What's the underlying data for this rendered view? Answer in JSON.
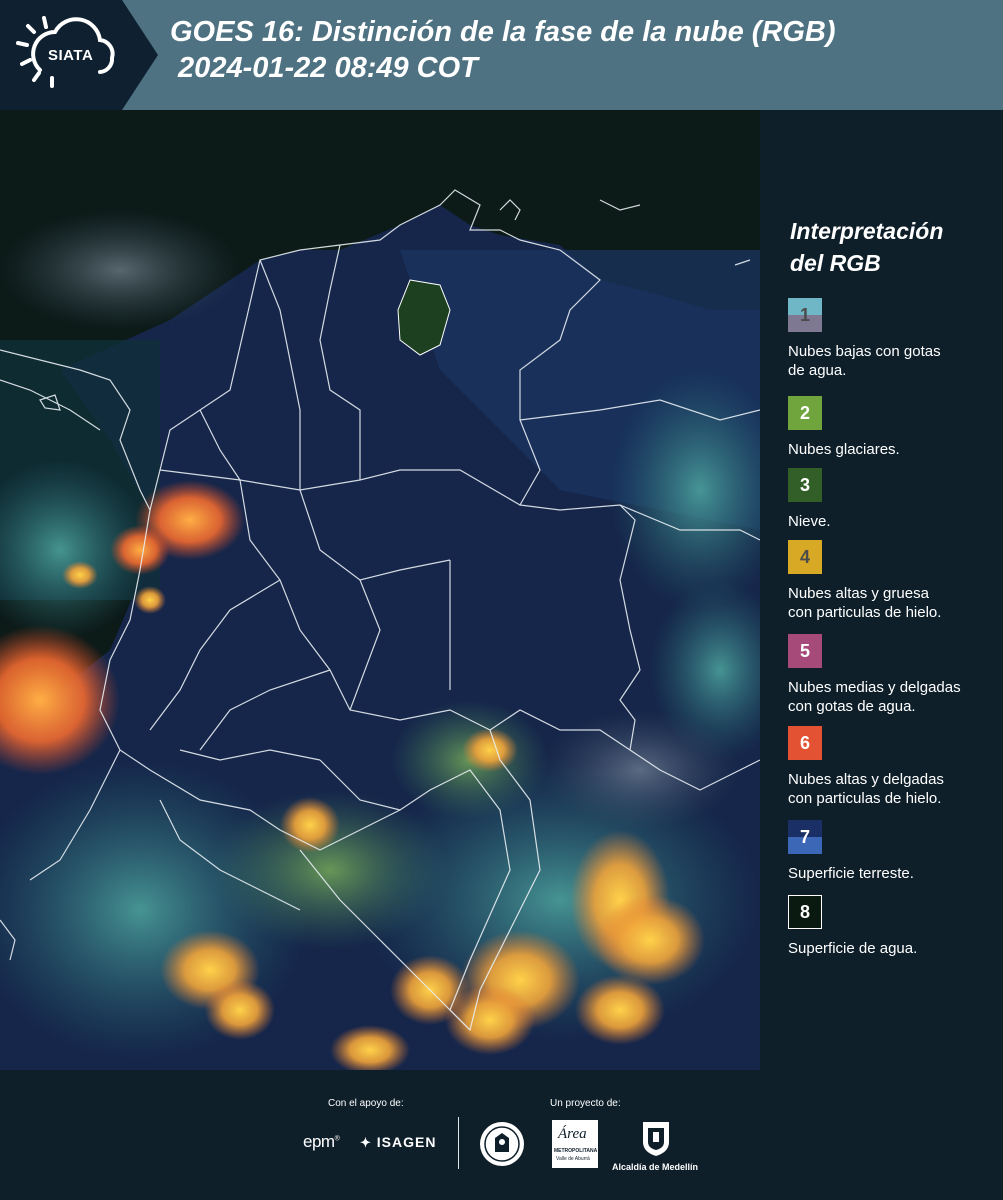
{
  "header": {
    "logo_text": "SIATA",
    "title_line1": "GOES 16: Distinción de la fase de la nube (RGB)",
    "title_line2": " 2024-01-22 08:49 COT"
  },
  "legend": {
    "title_line1": "Interpretación",
    "title_line2": "del RGB",
    "items": [
      {
        "number": "1",
        "label_line1": "Nubes bajas con gotas",
        "label_line2": "de agua.",
        "color_top": "#6fb6c6",
        "color_bottom": "#7e7892"
      },
      {
        "number": "2",
        "label_line1": "Nubes glaciares.",
        "label_line2": "",
        "color_top": "#6fa53c",
        "color_bottom": "#6fa53c"
      },
      {
        "number": "3",
        "label_line1": "Nieve.",
        "label_line2": "",
        "color_top": "#325f27",
        "color_bottom": "#325f27"
      },
      {
        "number": "4",
        "label_line1": "Nubes altas y gruesa",
        "label_line2": "con particulas de hielo.",
        "color_top": "#d7a925",
        "color_bottom": "#d7a925"
      },
      {
        "number": "5",
        "label_line1": "Nubes medias y delgadas",
        "label_line2": "con gotas de agua.",
        "color_top": "#a54a79",
        "color_bottom": "#a54a79"
      },
      {
        "number": "6",
        "label_line1": "Nubes altas y delgadas",
        "label_line2": "con particulas de hielo.",
        "color_top": "#e35232",
        "color_bottom": "#e35232"
      },
      {
        "number": "7",
        "label_line1": "Superficie terreste.",
        "label_line2": "",
        "color_top": "#1a2f66",
        "color_bottom": "#3c67b6"
      },
      {
        "number": "8",
        "label_line1": "Superficie de agua.",
        "label_line2": "",
        "color_top": "#0a1a10",
        "color_bottom": "#0a1a10"
      }
    ]
  },
  "footer": {
    "support_label": "Con el apoyo de:",
    "project_label": "Un proyecto de:",
    "epm": "epm",
    "isagen": "ISAGEN",
    "area_line1": "Área",
    "area_line2": "METROPOLITANA",
    "area_line3": "Valle de Aburrá",
    "alcaldia": "Alcaldía de Medellín"
  }
}
